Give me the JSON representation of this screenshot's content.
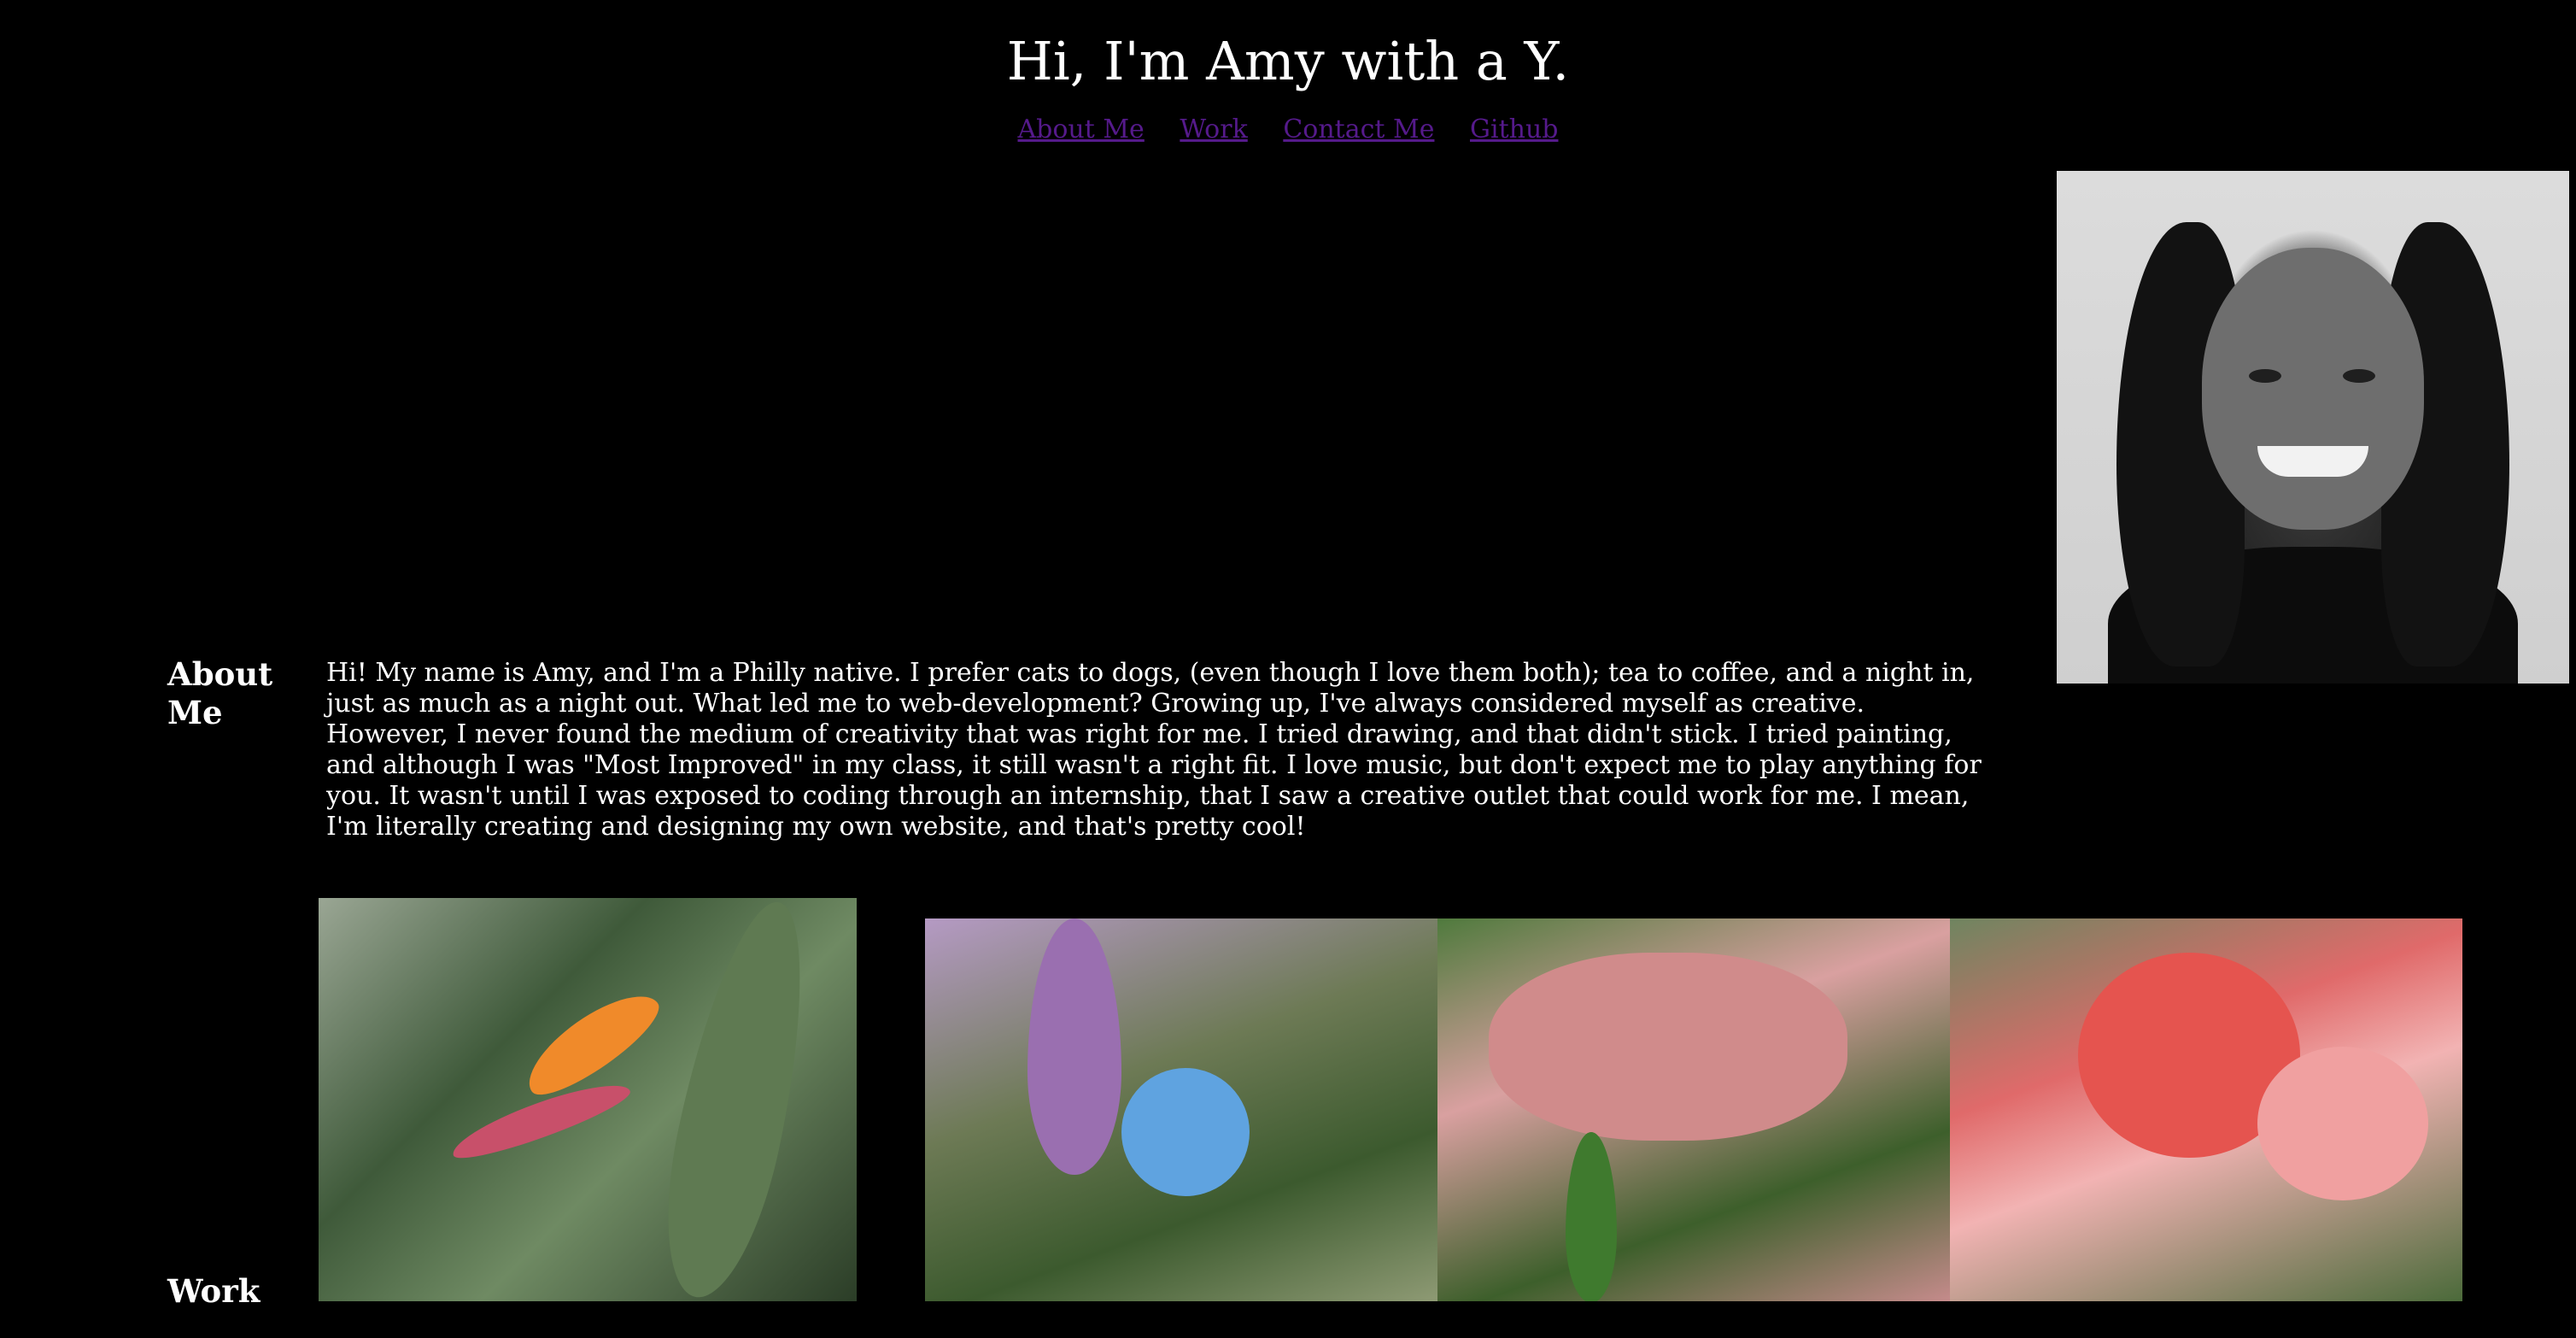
{
  "header": {
    "title": "Hi, I'm Amy with a Y."
  },
  "nav": {
    "links": [
      "About Me",
      "Work",
      "Contact Me",
      "Github"
    ]
  },
  "about": {
    "heading": "About Me",
    "text": "Hi! My name is Amy, and I'm a Philly native. I prefer cats to dogs, (even though I love them both); tea to coffee, and a night in, just as much as a night out. What led me to web-development? Growing up, I've always considered myself as creative. However, I never found the medium of creativity that was right for me. I tried drawing, and that didn't stick. I tried painting, and although I was \"Most Improved\" in my class, it still wasn't a right fit. I love music, but don't expect me to play anything for you. It wasn't until I was exposed to coding through an internship, that I saw a creative outlet that could work for me. I mean, I'm literally creating and designing my own website, and that's pretty cool!"
  },
  "work": {
    "heading": "Work"
  },
  "colors": {
    "background": "#000000",
    "text": "#ffffff",
    "link": "#551a8b"
  }
}
